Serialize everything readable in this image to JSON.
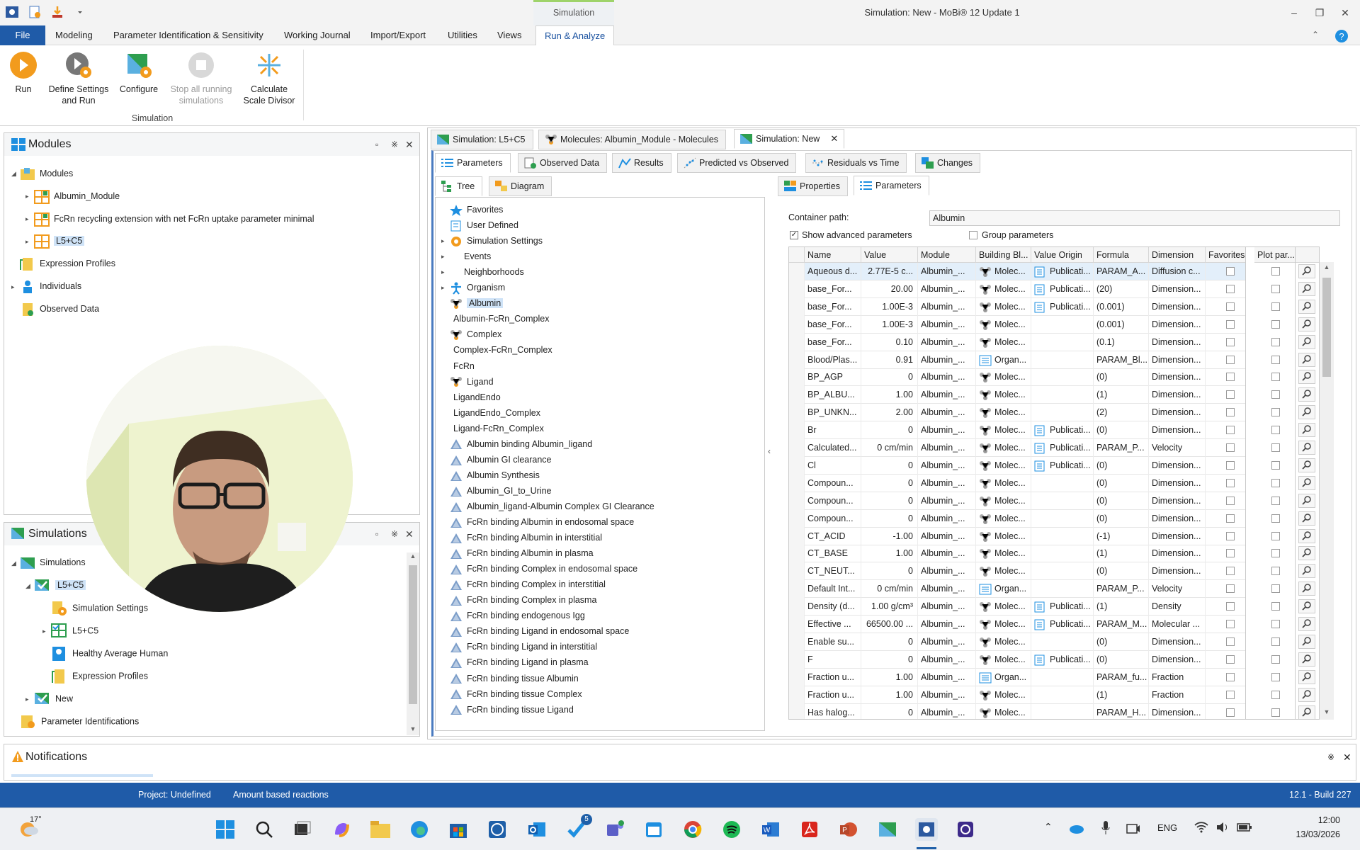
{
  "window": {
    "title": "Simulation: New - MoBi® 12 Update 1",
    "context_tab": "Simulation"
  },
  "menu": {
    "items": [
      "File",
      "Modeling",
      "Parameter Identification & Sensitivity",
      "Working Journal",
      "Import/Export",
      "Utilities",
      "Views",
      "Run & Analyze"
    ],
    "active": "Run & Analyze"
  },
  "ribbon": {
    "buttons": [
      {
        "line1": "Run",
        "line2": ""
      },
      {
        "line1": "Define Settings",
        "line2": "and Run"
      },
      {
        "line1": "Configure",
        "line2": ""
      },
      {
        "line1": "Stop all running",
        "line2": "simulations"
      },
      {
        "line1": "Calculate",
        "line2": "Scale Divisor"
      }
    ],
    "group_label": "Simulation"
  },
  "modules_panel": {
    "title": "Modules",
    "items": [
      "Modules",
      "Albumin_Module",
      "FcRn recycling extension with net FcRn uptake parameter minimal",
      "L5+C5",
      "Expression Profiles",
      "Individuals",
      "Observed Data"
    ]
  },
  "simulations_panel": {
    "title": "Simulations",
    "items": [
      "Simulations",
      "L5+C5",
      "Simulation Settings",
      "L5+C5",
      "Healthy Average Human",
      "Expression Profiles",
      "New",
      "Parameter Identifications"
    ]
  },
  "notifications": {
    "title": "Notifications"
  },
  "doc_tabs": [
    "Simulation: L5+C5",
    "Molecules: Albumin_Module - Molecules",
    "Simulation: New"
  ],
  "sub_tabs": [
    "Parameters",
    "Observed Data",
    "Results",
    "Predicted vs Observed",
    "Residuals vs Time",
    "Changes"
  ],
  "view_tabs": [
    "Tree",
    "Diagram"
  ],
  "right_tabs": [
    "Properties",
    "Parameters"
  ],
  "tree": [
    "Favorites",
    "User Defined",
    "Simulation Settings",
    "Events",
    "Neighborhoods",
    "Organism",
    "Albumin",
    "Albumin-FcRn_Complex",
    "Complex",
    "Complex-FcRn_Complex",
    "FcRn",
    "Ligand",
    "LigandEndo",
    "LigandEndo_Complex",
    "Ligand-FcRn_Complex",
    "Albumin binding Albumin_ligand",
    "Albumin GI clearance",
    "Albumin Synthesis",
    "Albumin_GI_to_Urine",
    "Albumin_ligand-Albumin Complex GI Clearance",
    "FcRn binding Albumin in endosomal space",
    "FcRn binding Albumin in interstitial",
    "FcRn binding Albumin in plasma",
    "FcRn binding Complex in endosomal space",
    "FcRn binding Complex in interstitial",
    "FcRn binding Complex in plasma",
    "FcRn binding endogenous Igg",
    "FcRn binding Ligand in endosomal space",
    "FcRn binding Ligand in interstitial",
    "FcRn binding Ligand in plasma",
    "FcRn binding tissue Albumin",
    "FcRn binding tissue Complex",
    "FcRn binding tissue Ligand"
  ],
  "params": {
    "container_label": "Container path:",
    "container_value": "Albumin",
    "show_advanced": "Show advanced parameters",
    "group_params": "Group parameters",
    "columns": [
      "Name",
      "Value",
      "Module",
      "Building Bl...",
      "Value Origin",
      "Formula",
      "Dimension",
      "Favorites",
      "Plot par..."
    ],
    "rows": [
      [
        "Aqueous d...",
        "2.77E-5 c...",
        "Albumin_...",
        "Molec...",
        "Publicati...",
        "PARAM_A...",
        "Diffusion c..."
      ],
      [
        "base_For...",
        "20.00",
        "Albumin_...",
        "Molec...",
        "Publicati...",
        "(20)",
        "Dimension..."
      ],
      [
        "base_For...",
        "1.00E-3",
        "Albumin_...",
        "Molec...",
        "Publicati...",
        "(0.001)",
        "Dimension..."
      ],
      [
        "base_For...",
        "1.00E-3",
        "Albumin_...",
        "Molec...",
        "",
        "(0.001)",
        "Dimension..."
      ],
      [
        "base_For...",
        "0.10",
        "Albumin_...",
        "Molec...",
        "",
        "(0.1)",
        "Dimension..."
      ],
      [
        "Blood/Plas...",
        "0.91",
        "Albumin_...",
        "Organ...",
        "",
        "PARAM_Bl...",
        "Dimension..."
      ],
      [
        "BP_AGP",
        "0",
        "Albumin_...",
        "Molec...",
        "",
        "(0)",
        "Dimension..."
      ],
      [
        "BP_ALBU...",
        "1.00",
        "Albumin_...",
        "Molec...",
        "",
        "(1)",
        "Dimension..."
      ],
      [
        "BP_UNKN...",
        "2.00",
        "Albumin_...",
        "Molec...",
        "",
        "(2)",
        "Dimension..."
      ],
      [
        "Br",
        "0",
        "Albumin_...",
        "Molec...",
        "Publicati...",
        "(0)",
        "Dimension..."
      ],
      [
        "Calculated...",
        "0 cm/min",
        "Albumin_...",
        "Molec...",
        "Publicati...",
        "PARAM_P...",
        "Velocity"
      ],
      [
        "Cl",
        "0",
        "Albumin_...",
        "Molec...",
        "Publicati...",
        "(0)",
        "Dimension..."
      ],
      [
        "Compoun...",
        "0",
        "Albumin_...",
        "Molec...",
        "",
        "(0)",
        "Dimension..."
      ],
      [
        "Compoun...",
        "0",
        "Albumin_...",
        "Molec...",
        "",
        "(0)",
        "Dimension..."
      ],
      [
        "Compoun...",
        "0",
        "Albumin_...",
        "Molec...",
        "",
        "(0)",
        "Dimension..."
      ],
      [
        "CT_ACID",
        "-1.00",
        "Albumin_...",
        "Molec...",
        "",
        "(-1)",
        "Dimension..."
      ],
      [
        "CT_BASE",
        "1.00",
        "Albumin_...",
        "Molec...",
        "",
        "(1)",
        "Dimension..."
      ],
      [
        "CT_NEUT...",
        "0",
        "Albumin_...",
        "Molec...",
        "",
        "(0)",
        "Dimension..."
      ],
      [
        "Default Int...",
        "0 cm/min",
        "Albumin_...",
        "Organ...",
        "",
        "PARAM_P...",
        "Velocity"
      ],
      [
        "Density (d...",
        "1.00 g/cm³",
        "Albumin_...",
        "Molec...",
        "Publicati...",
        "(1)",
        "Density"
      ],
      [
        "Effective ...",
        "66500.00 ...",
        "Albumin_...",
        "Molec...",
        "Publicati...",
        "PARAM_M...",
        "Molecular ..."
      ],
      [
        "Enable su...",
        "0",
        "Albumin_...",
        "Molec...",
        "",
        "(0)",
        "Dimension..."
      ],
      [
        "F",
        "0",
        "Albumin_...",
        "Molec...",
        "Publicati...",
        "(0)",
        "Dimension..."
      ],
      [
        "Fraction u...",
        "1.00",
        "Albumin_...",
        "Organ...",
        "",
        "PARAM_fu...",
        "Fraction"
      ],
      [
        "Fraction u...",
        "1.00",
        "Albumin_...",
        "Molec...",
        "",
        "(1)",
        "Fraction"
      ],
      [
        "Has halog...",
        "0",
        "Albumin_...",
        "Molec...",
        "",
        "PARAM_H...",
        "Dimension..."
      ]
    ]
  },
  "status": {
    "project": "Project: Undefined",
    "mode": "Amount based reactions",
    "build": "12.1 - Build 227"
  },
  "taskbar": {
    "weather": "17°",
    "lang": "ENG",
    "time": "12:00",
    "date": "13/03/2026",
    "badge": "5"
  },
  "colors": {
    "accent": "#1f5ba8",
    "orange": "#f29b1d",
    "selection": "#cfe3f7",
    "green": "#2e9e4f"
  }
}
